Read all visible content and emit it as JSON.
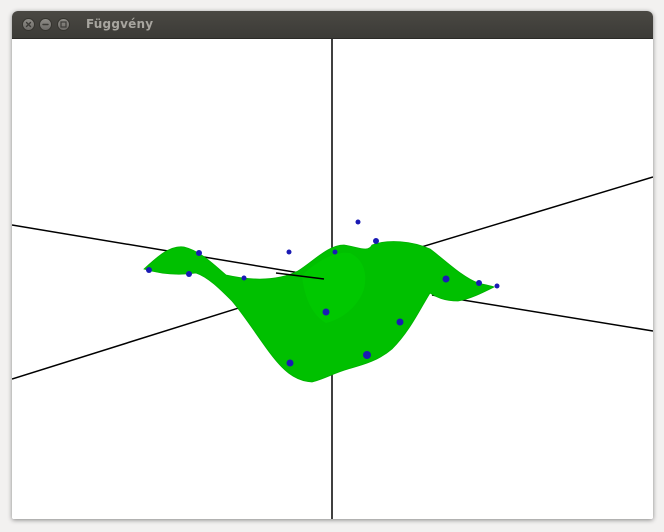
{
  "window": {
    "title": "Függvény"
  },
  "controls": {
    "close": "close-icon",
    "minimize": "minimize-icon",
    "maximize": "maximize-icon"
  },
  "colors": {
    "titlebar": "#3c3b37",
    "title_text": "#a7a59f",
    "surface": "#00c000",
    "points": "#1a1ab4",
    "axes": "#000000",
    "background": "#ffffff"
  }
}
